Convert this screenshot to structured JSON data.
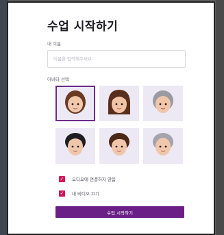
{
  "join": {
    "title": "수업 시작하기",
    "name_label": "내 이름",
    "name_placeholder": "이름을 입력해주세요",
    "avatar_label": "아바타 선택",
    "avatars": [
      {
        "icon": "female-avatar-brown-hair-icon",
        "selected": true
      },
      {
        "icon": "female-avatar-long-brown-hair-icon",
        "selected": false
      },
      {
        "icon": "male-avatar-gray-hair-icon",
        "selected": false
      },
      {
        "icon": "male-avatar-black-hair-icon",
        "selected": false
      },
      {
        "icon": "male-avatar-brown-hair-icon",
        "selected": false
      },
      {
        "icon": "male-avatar-gray-short-hair-icon",
        "selected": false
      }
    ],
    "audio_option": "오디오에 연결하지 않음",
    "video_option": "내 비디오 끄기",
    "start_button": "수업 시작하기"
  },
  "colors": {
    "accent": "#6a1f86",
    "checkbox": "#d4145a",
    "tile_bg": "#ece8f4"
  }
}
